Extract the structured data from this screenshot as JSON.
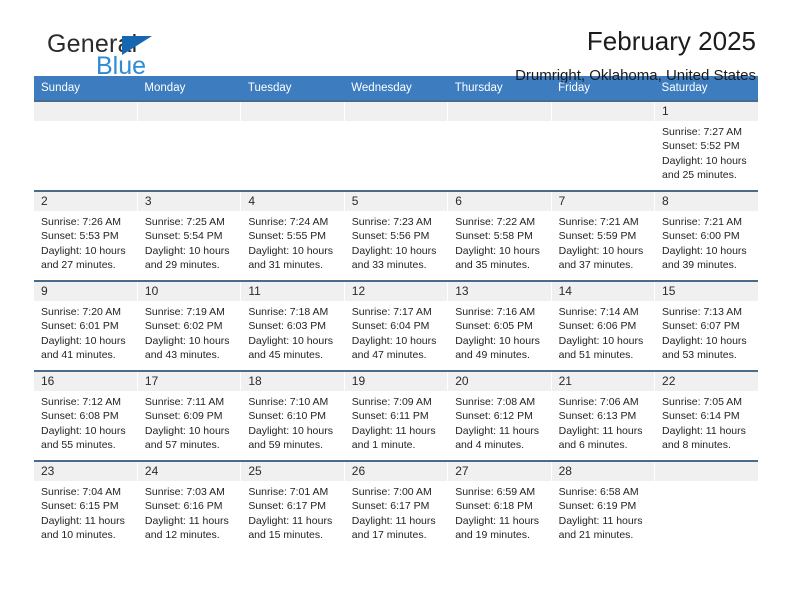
{
  "brand": {
    "name_top": "General",
    "name_bottom": "Blue",
    "accent_dark": "#1567b2",
    "accent_light": "#2e8bd6"
  },
  "header": {
    "title": "February 2025",
    "subtitle": "Drumright, Oklahoma, United States"
  },
  "theme": {
    "header_row_bg": "#3c7cbf",
    "daynum_bg": "#f0f0f0",
    "row_divider": "#4a6b8a"
  },
  "weekdays": [
    "Sunday",
    "Monday",
    "Tuesday",
    "Wednesday",
    "Thursday",
    "Friday",
    "Saturday"
  ],
  "labels": {
    "sunrise_prefix": "Sunrise:",
    "sunset_prefix": "Sunset:",
    "daylight_prefix": "Daylight:"
  },
  "weeks": [
    [
      {
        "day": "",
        "empty": true
      },
      {
        "day": "",
        "empty": true
      },
      {
        "day": "",
        "empty": true
      },
      {
        "day": "",
        "empty": true
      },
      {
        "day": "",
        "empty": true
      },
      {
        "day": "",
        "empty": true
      },
      {
        "day": "1",
        "sunrise": "Sunrise: 7:27 AM",
        "sunset": "Sunset: 5:52 PM",
        "daylight": "Daylight: 10 hours and 25 minutes."
      }
    ],
    [
      {
        "day": "2",
        "sunrise": "Sunrise: 7:26 AM",
        "sunset": "Sunset: 5:53 PM",
        "daylight": "Daylight: 10 hours and 27 minutes."
      },
      {
        "day": "3",
        "sunrise": "Sunrise: 7:25 AM",
        "sunset": "Sunset: 5:54 PM",
        "daylight": "Daylight: 10 hours and 29 minutes."
      },
      {
        "day": "4",
        "sunrise": "Sunrise: 7:24 AM",
        "sunset": "Sunset: 5:55 PM",
        "daylight": "Daylight: 10 hours and 31 minutes."
      },
      {
        "day": "5",
        "sunrise": "Sunrise: 7:23 AM",
        "sunset": "Sunset: 5:56 PM",
        "daylight": "Daylight: 10 hours and 33 minutes."
      },
      {
        "day": "6",
        "sunrise": "Sunrise: 7:22 AM",
        "sunset": "Sunset: 5:58 PM",
        "daylight": "Daylight: 10 hours and 35 minutes."
      },
      {
        "day": "7",
        "sunrise": "Sunrise: 7:21 AM",
        "sunset": "Sunset: 5:59 PM",
        "daylight": "Daylight: 10 hours and 37 minutes."
      },
      {
        "day": "8",
        "sunrise": "Sunrise: 7:21 AM",
        "sunset": "Sunset: 6:00 PM",
        "daylight": "Daylight: 10 hours and 39 minutes."
      }
    ],
    [
      {
        "day": "9",
        "sunrise": "Sunrise: 7:20 AM",
        "sunset": "Sunset: 6:01 PM",
        "daylight": "Daylight: 10 hours and 41 minutes."
      },
      {
        "day": "10",
        "sunrise": "Sunrise: 7:19 AM",
        "sunset": "Sunset: 6:02 PM",
        "daylight": "Daylight: 10 hours and 43 minutes."
      },
      {
        "day": "11",
        "sunrise": "Sunrise: 7:18 AM",
        "sunset": "Sunset: 6:03 PM",
        "daylight": "Daylight: 10 hours and 45 minutes."
      },
      {
        "day": "12",
        "sunrise": "Sunrise: 7:17 AM",
        "sunset": "Sunset: 6:04 PM",
        "daylight": "Daylight: 10 hours and 47 minutes."
      },
      {
        "day": "13",
        "sunrise": "Sunrise: 7:16 AM",
        "sunset": "Sunset: 6:05 PM",
        "daylight": "Daylight: 10 hours and 49 minutes."
      },
      {
        "day": "14",
        "sunrise": "Sunrise: 7:14 AM",
        "sunset": "Sunset: 6:06 PM",
        "daylight": "Daylight: 10 hours and 51 minutes."
      },
      {
        "day": "15",
        "sunrise": "Sunrise: 7:13 AM",
        "sunset": "Sunset: 6:07 PM",
        "daylight": "Daylight: 10 hours and 53 minutes."
      }
    ],
    [
      {
        "day": "16",
        "sunrise": "Sunrise: 7:12 AM",
        "sunset": "Sunset: 6:08 PM",
        "daylight": "Daylight: 10 hours and 55 minutes."
      },
      {
        "day": "17",
        "sunrise": "Sunrise: 7:11 AM",
        "sunset": "Sunset: 6:09 PM",
        "daylight": "Daylight: 10 hours and 57 minutes."
      },
      {
        "day": "18",
        "sunrise": "Sunrise: 7:10 AM",
        "sunset": "Sunset: 6:10 PM",
        "daylight": "Daylight: 10 hours and 59 minutes."
      },
      {
        "day": "19",
        "sunrise": "Sunrise: 7:09 AM",
        "sunset": "Sunset: 6:11 PM",
        "daylight": "Daylight: 11 hours and 1 minute."
      },
      {
        "day": "20",
        "sunrise": "Sunrise: 7:08 AM",
        "sunset": "Sunset: 6:12 PM",
        "daylight": "Daylight: 11 hours and 4 minutes."
      },
      {
        "day": "21",
        "sunrise": "Sunrise: 7:06 AM",
        "sunset": "Sunset: 6:13 PM",
        "daylight": "Daylight: 11 hours and 6 minutes."
      },
      {
        "day": "22",
        "sunrise": "Sunrise: 7:05 AM",
        "sunset": "Sunset: 6:14 PM",
        "daylight": "Daylight: 11 hours and 8 minutes."
      }
    ],
    [
      {
        "day": "23",
        "sunrise": "Sunrise: 7:04 AM",
        "sunset": "Sunset: 6:15 PM",
        "daylight": "Daylight: 11 hours and 10 minutes."
      },
      {
        "day": "24",
        "sunrise": "Sunrise: 7:03 AM",
        "sunset": "Sunset: 6:16 PM",
        "daylight": "Daylight: 11 hours and 12 minutes."
      },
      {
        "day": "25",
        "sunrise": "Sunrise: 7:01 AM",
        "sunset": "Sunset: 6:17 PM",
        "daylight": "Daylight: 11 hours and 15 minutes."
      },
      {
        "day": "26",
        "sunrise": "Sunrise: 7:00 AM",
        "sunset": "Sunset: 6:17 PM",
        "daylight": "Daylight: 11 hours and 17 minutes."
      },
      {
        "day": "27",
        "sunrise": "Sunrise: 6:59 AM",
        "sunset": "Sunset: 6:18 PM",
        "daylight": "Daylight: 11 hours and 19 minutes."
      },
      {
        "day": "28",
        "sunrise": "Sunrise: 6:58 AM",
        "sunset": "Sunset: 6:19 PM",
        "daylight": "Daylight: 11 hours and 21 minutes."
      },
      {
        "day": "",
        "empty": true
      }
    ]
  ]
}
